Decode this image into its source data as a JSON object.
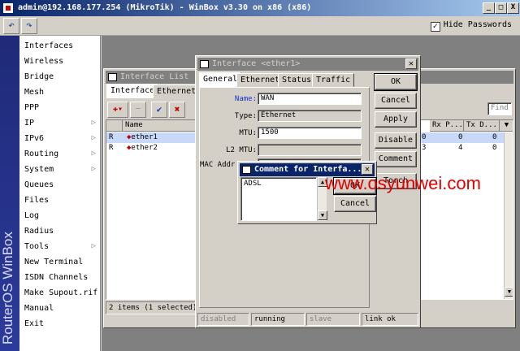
{
  "window": {
    "title": "admin@192.168.177.254 (MikroTik) - WinBox v3.30 on x86 (x86)",
    "minimize_glyph": "_",
    "maximize_glyph": "□",
    "close_glyph": "X"
  },
  "toolbar": {
    "undo_glyph": "↶",
    "redo_glyph": "↷",
    "hide_passwords_label": "Hide Passwords",
    "hide_passwords_checked": "✓"
  },
  "brand": {
    "text": "RouterOS WinBox"
  },
  "menu": {
    "items": [
      {
        "label": "Interfaces",
        "arrow": ""
      },
      {
        "label": "Wireless",
        "arrow": ""
      },
      {
        "label": "Bridge",
        "arrow": ""
      },
      {
        "label": "Mesh",
        "arrow": ""
      },
      {
        "label": "PPP",
        "arrow": ""
      },
      {
        "label": "IP",
        "arrow": "▷"
      },
      {
        "label": "IPv6",
        "arrow": "▷"
      },
      {
        "label": "Routing",
        "arrow": "▷"
      },
      {
        "label": "System",
        "arrow": "▷"
      },
      {
        "label": "Queues",
        "arrow": ""
      },
      {
        "label": "Files",
        "arrow": ""
      },
      {
        "label": "Log",
        "arrow": ""
      },
      {
        "label": "Radius",
        "arrow": ""
      },
      {
        "label": "Tools",
        "arrow": "▷"
      },
      {
        "label": "New Terminal",
        "arrow": ""
      },
      {
        "label": "ISDN Channels",
        "arrow": ""
      },
      {
        "label": "Make Supout.rif",
        "arrow": ""
      },
      {
        "label": "Manual",
        "arrow": ""
      },
      {
        "label": "Exit",
        "arrow": ""
      }
    ]
  },
  "interface_list": {
    "title": "Interface List",
    "tabs": [
      "Interface",
      "Ethernet"
    ],
    "toolbar": {
      "add": "✚▾",
      "remove": "—",
      "enable": "✔",
      "disable": "✖"
    },
    "find_placeholder": "Find",
    "columns": {
      "flag": "",
      "name": "Name",
      "rx_packets": "Rx P...",
      "tx_drops": "Tx D..."
    },
    "rows": [
      {
        "flag": "R",
        "name": "ether1",
        "rx_extra": "0",
        "rx_packets": "0",
        "tx_drops": "0"
      },
      {
        "flag": "R",
        "name": "ether2",
        "rx_extra": "3",
        "rx_packets": "4",
        "tx_drops": "0"
      }
    ],
    "status": "2 items (1 selected)"
  },
  "interface_dialog": {
    "title": "Interface <ether1>",
    "tabs": [
      "General",
      "Ethernet",
      "Status",
      "Traffic"
    ],
    "fields": {
      "name_label": "Name:",
      "name_value": "WAN",
      "type_label": "Type:",
      "type_value": "Ethernet",
      "mtu_label": "MTU:",
      "mtu_value": "1500",
      "l2mtu_label": "L2 MTU:",
      "mac_label": "MAC Addr"
    },
    "buttons": {
      "ok": "OK",
      "cancel": "Cancel",
      "apply": "Apply",
      "disable": "Disable",
      "comment": "Comment",
      "torch": "Torch"
    },
    "status": {
      "disabled": "disabled",
      "running": "running",
      "slave": "slave",
      "link": "link ok"
    }
  },
  "comment_dialog": {
    "title": "Comment for Interfa...",
    "text": "ADSL",
    "ok": "OK",
    "cancel": "Cancel"
  },
  "watermark": {
    "text": "www.osyunwei.com"
  },
  "colors": {
    "titlebar": "#0a246a",
    "workspace": "#808080",
    "selected_row": "#c8d8f8",
    "watermark": "#e00000",
    "brand": "#2c3a9a"
  }
}
